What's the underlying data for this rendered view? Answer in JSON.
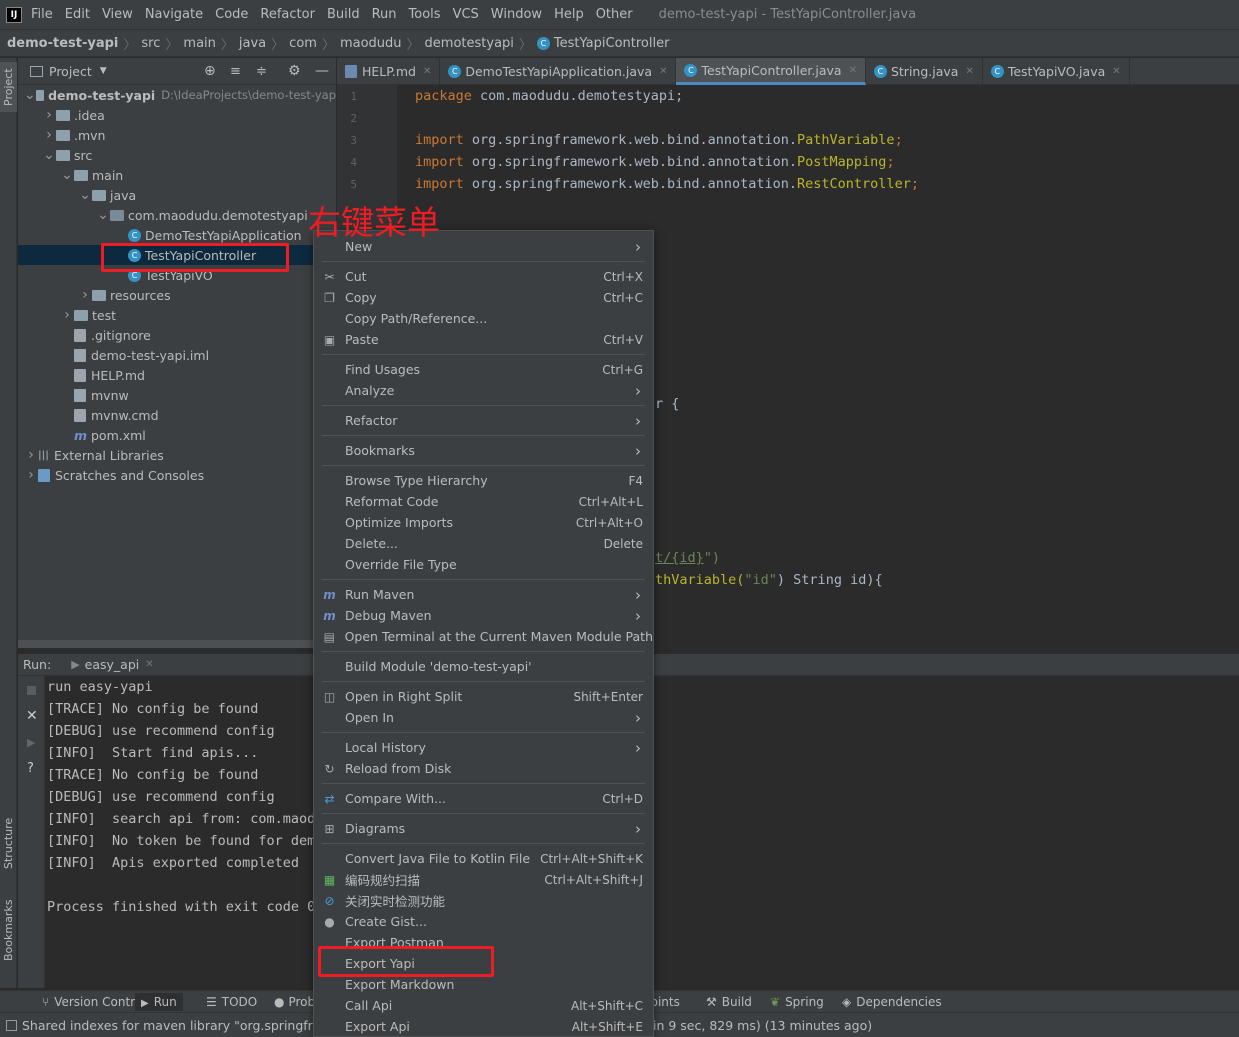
{
  "menubar": {
    "items": [
      "File",
      "Edit",
      "View",
      "Navigate",
      "Code",
      "Refactor",
      "Build",
      "Run",
      "Tools",
      "VCS",
      "Window",
      "Help",
      "Other"
    ],
    "window_title": "demo-test-yapi - TestYapiController.java",
    "logo": "IJ"
  },
  "breadcrumb": [
    "demo-test-yapi",
    "src",
    "main",
    "java",
    "com",
    "maodudu",
    "demotestyapi",
    "TestYapiController"
  ],
  "leftstrip": {
    "project": "Project",
    "structure": "Structure",
    "bookmarks": "Bookmarks"
  },
  "project_panel": {
    "title": "Project"
  },
  "tree": [
    {
      "label": "demo-test-yapi",
      "extra": "D:\\IdeaProjects\\demo-test-yap",
      "arrow": "v",
      "icon": "folder-icon",
      "depth": 0,
      "bold": true
    },
    {
      "label": ".idea",
      "arrow": ">",
      "icon": "folder-icon",
      "depth": 1
    },
    {
      "label": ".mvn",
      "arrow": ">",
      "icon": "folder-icon",
      "depth": 1
    },
    {
      "label": "src",
      "arrow": "v",
      "icon": "folder-icon",
      "depth": 1
    },
    {
      "label": "main",
      "arrow": "v",
      "icon": "folder-icon",
      "depth": 2
    },
    {
      "label": "java",
      "arrow": "v",
      "icon": "folder-icon",
      "depth": 3
    },
    {
      "label": "com.maodudu.demotestyapi",
      "arrow": "v",
      "icon": "package-icon",
      "depth": 4
    },
    {
      "label": "DemoTestYapiApplication",
      "arrow": "",
      "icon": "class-icon",
      "depth": 5
    },
    {
      "label": "TestYapiController",
      "arrow": "",
      "icon": "class-icon",
      "depth": 5,
      "selected": true
    },
    {
      "label": "TestYapiVO",
      "arrow": "",
      "icon": "class-icon",
      "depth": 5
    },
    {
      "label": "resources",
      "arrow": ">",
      "icon": "folder-icon",
      "depth": 3
    },
    {
      "label": "test",
      "arrow": ">",
      "icon": "folder-icon",
      "depth": 2
    },
    {
      "label": ".gitignore",
      "arrow": "",
      "icon": "file-icon",
      "depth": 2
    },
    {
      "label": "demo-test-yapi.iml",
      "arrow": "",
      "icon": "file-icon",
      "depth": 2
    },
    {
      "label": "HELP.md",
      "arrow": "",
      "icon": "file-icon",
      "depth": 2
    },
    {
      "label": "mvnw",
      "arrow": "",
      "icon": "file-icon",
      "depth": 2
    },
    {
      "label": "mvnw.cmd",
      "arrow": "",
      "icon": "file-icon",
      "depth": 2
    },
    {
      "label": "pom.xml",
      "arrow": "",
      "icon": "maven-icon",
      "depth": 2
    },
    {
      "label": "External Libraries",
      "arrow": ">",
      "icon": "library-icon",
      "depth": 0
    },
    {
      "label": "Scratches and Consoles",
      "arrow": ">",
      "icon": "scratch-icon",
      "depth": 0
    }
  ],
  "tabs": [
    {
      "label": "HELP.md",
      "active": false
    },
    {
      "label": "DemoTestYapiApplication.java",
      "active": false
    },
    {
      "label": "TestYapiController.java",
      "active": true
    },
    {
      "label": "String.java",
      "active": false
    },
    {
      "label": "TestYapiVO.java",
      "active": false
    }
  ],
  "editor": {
    "line_numbers": [
      "1",
      "2",
      "3",
      "4",
      "5"
    ],
    "line1": {
      "kw": "package",
      "rest": " com.maodudu.demotestyapi;"
    },
    "import_kw": "import",
    "import_pkg": " org.springframework.web.bind.annotation.",
    "imports": [
      "PathVariable",
      "PostMapping",
      "RestController"
    ],
    "semi": ";",
    "frag_brace": "r {",
    "frag_path_str": "t/{id}",
    "frag_path_end": "\")",
    "frag_pv": "thVariable(",
    "frag_id": "\"id\"",
    "frag_tail": ") String id){"
  },
  "annotation_text": "右键菜单",
  "run_panel": {
    "label": "Run:",
    "tab": "easy_api"
  },
  "console_lines": [
    "run easy-yapi",
    "[TRACE] No config be found",
    "[DEBUG] use recommend config",
    "[INFO]  Start find apis...",
    "[TRACE] No config be found",
    "[DEBUG] use recommend config",
    "[INFO]  search api from: com.maod",
    "[INFO]  No token be found for dem",
    "[INFO]  Apis exported completed",
    "",
    "Process finished with exit code 0"
  ],
  "bottom_tools": [
    "Version Control",
    "Run",
    "TODO",
    "Prob",
    "points",
    "Build",
    "Spring",
    "Dependencies"
  ],
  "status": {
    "left": "Shared indexes for maven library \"org.springfram",
    "right": "in 9 sec, 829 ms) (13 minutes ago)"
  },
  "context_menu": [
    {
      "label": "New",
      "shortcut": "",
      "submenu": true,
      "icon": ""
    },
    {
      "sep": true
    },
    {
      "label": "Cut",
      "shortcut": "Ctrl+X",
      "icon": "scissors-icon"
    },
    {
      "label": "Copy",
      "shortcut": "Ctrl+C",
      "icon": "copy-icon"
    },
    {
      "label": "Copy Path/Reference...",
      "shortcut": "",
      "icon": ""
    },
    {
      "label": "Paste",
      "shortcut": "Ctrl+V",
      "icon": "paste-icon"
    },
    {
      "sep": true
    },
    {
      "label": "Find Usages",
      "shortcut": "Ctrl+G",
      "icon": ""
    },
    {
      "label": "Analyze",
      "shortcut": "",
      "submenu": true,
      "icon": ""
    },
    {
      "sep": true
    },
    {
      "label": "Refactor",
      "shortcut": "",
      "submenu": true,
      "icon": ""
    },
    {
      "sep": true
    },
    {
      "label": "Bookmarks",
      "shortcut": "",
      "submenu": true,
      "icon": ""
    },
    {
      "sep": true
    },
    {
      "label": "Browse Type Hierarchy",
      "shortcut": "F4",
      "icon": ""
    },
    {
      "label": "Reformat Code",
      "shortcut": "Ctrl+Alt+L",
      "icon": ""
    },
    {
      "label": "Optimize Imports",
      "shortcut": "Ctrl+Alt+O",
      "icon": ""
    },
    {
      "label": "Delete...",
      "shortcut": "Delete",
      "icon": ""
    },
    {
      "label": "Override File Type",
      "shortcut": "",
      "icon": ""
    },
    {
      "sep": true
    },
    {
      "label": "Run Maven",
      "shortcut": "",
      "submenu": true,
      "icon": "maven-icon"
    },
    {
      "label": "Debug Maven",
      "shortcut": "",
      "submenu": true,
      "icon": "maven-icon"
    },
    {
      "label": "Open Terminal at the Current Maven Module Path",
      "shortcut": "",
      "icon": "terminal-icon"
    },
    {
      "sep": true
    },
    {
      "label": "Build Module 'demo-test-yapi'",
      "shortcut": "",
      "icon": ""
    },
    {
      "sep": true
    },
    {
      "label": "Open in Right Split",
      "shortcut": "Shift+Enter",
      "icon": "split-icon"
    },
    {
      "label": "Open In",
      "shortcut": "",
      "submenu": true,
      "icon": ""
    },
    {
      "sep": true
    },
    {
      "label": "Local History",
      "shortcut": "",
      "submenu": true,
      "icon": ""
    },
    {
      "label": "Reload from Disk",
      "shortcut": "",
      "icon": "reload-icon"
    },
    {
      "sep": true
    },
    {
      "label": "Compare With...",
      "shortcut": "Ctrl+D",
      "icon": "compare-icon"
    },
    {
      "sep": true
    },
    {
      "label": "Diagrams",
      "shortcut": "",
      "submenu": true,
      "icon": "diagram-icon"
    },
    {
      "sep": true
    },
    {
      "label": "Convert Java File to Kotlin File",
      "shortcut": "Ctrl+Alt+Shift+K",
      "icon": ""
    },
    {
      "label": "编码规约扫描",
      "shortcut": "Ctrl+Alt+Shift+J",
      "icon": "scan-icon"
    },
    {
      "label": "关闭实时检测功能",
      "shortcut": "",
      "icon": "block-icon"
    },
    {
      "label": "Create Gist...",
      "shortcut": "",
      "icon": "github-icon"
    },
    {
      "label": "Export Postman",
      "shortcut": "",
      "icon": ""
    },
    {
      "label": "Export Yapi",
      "shortcut": "",
      "icon": "",
      "highlight": true
    },
    {
      "label": "Export Markdown",
      "shortcut": "",
      "icon": ""
    },
    {
      "label": "Call Api",
      "shortcut": "Alt+Shift+C",
      "icon": ""
    },
    {
      "label": "Export Api",
      "shortcut": "Alt+Shift+E",
      "icon": ""
    }
  ],
  "colors": {
    "annotation": "#ee1c24",
    "selection": "#0d293e",
    "keyword": "#cc7832",
    "annotation_code": "#bbb529"
  }
}
